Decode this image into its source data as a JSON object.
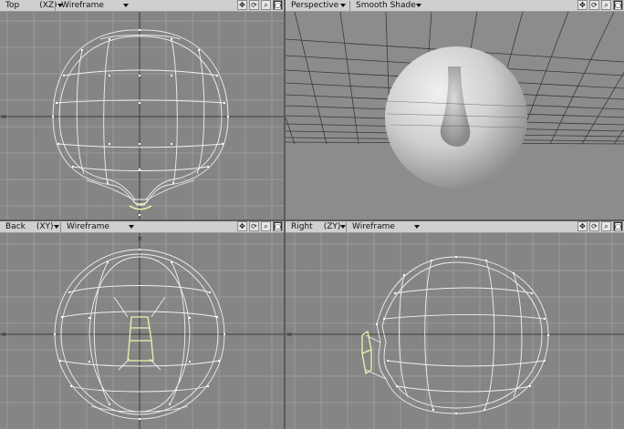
{
  "viewports": {
    "top": {
      "view": "Top",
      "axis": "(XZ)",
      "mode": "Wireframe"
    },
    "perspective": {
      "view": "Perspective",
      "mode": "Smooth Shade"
    },
    "back": {
      "view": "Back",
      "axis": "(XY)",
      "mode": "Wireframe"
    },
    "right": {
      "view": "Right",
      "axis": "(ZY)",
      "mode": "Wireframe"
    }
  },
  "tool_icons": [
    "move-icon",
    "rotate-icon",
    "zoom-icon",
    "maximize-icon"
  ],
  "tool_glyphs": {
    "move": "✥",
    "rotate": "⟳",
    "zoom": "⌕",
    "maximize": "◙"
  },
  "colors": {
    "grid_bg": "#858585",
    "grid_line": "#9a9a9a",
    "wire": "#f0f0f0",
    "selected_wire": "#f2f2b0",
    "header_bg": "#cfcfcf"
  }
}
